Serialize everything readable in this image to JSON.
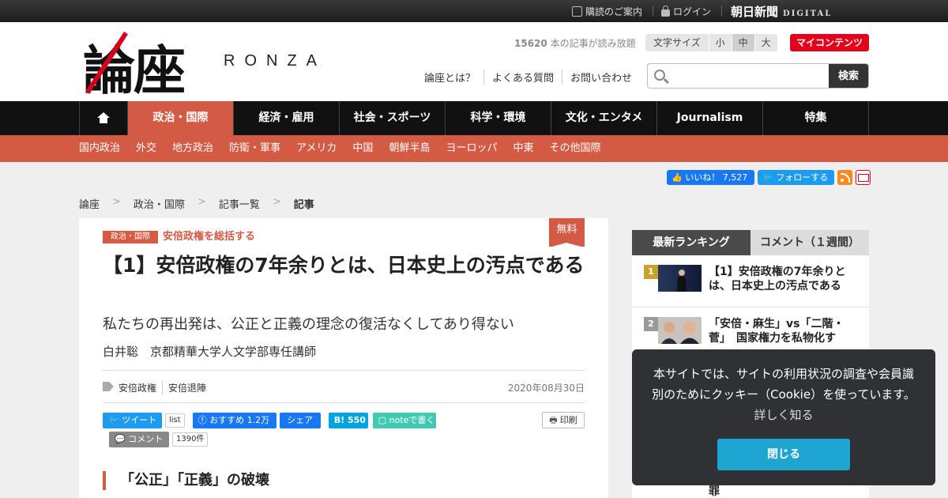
{
  "topbar": {
    "subscription": "購読のご案内",
    "login": "ログイン",
    "brand": "朝日新聞",
    "brand_sub": "DIGITAL"
  },
  "header": {
    "logo_kanji": "論座",
    "logo_roman": "RONZA",
    "read_count": "15620",
    "read_count_suffix": " 本の記事が読み放題",
    "font_size_label": "文字サイズ",
    "font_sizes": [
      "小",
      "中",
      "大"
    ],
    "font_size_selected": "中",
    "my_contents": "マイコンテンツ",
    "links": [
      "論座とは？",
      "よくある質問",
      "お問い合わせ"
    ],
    "search_placeholder": "",
    "search_button": "検索"
  },
  "nav": {
    "items": [
      "政治・国際",
      "経済・雇用",
      "社会・スポーツ",
      "科学・環境",
      "文化・エンタメ",
      "Journalism",
      "特集"
    ],
    "active": "政治・国際"
  },
  "subnav": {
    "items": [
      "国内政治",
      "外交",
      "地方政治",
      "防衛・軍事",
      "アメリカ",
      "中国",
      "朝鮮半島",
      "ヨーロッパ",
      "中東",
      "その他国際"
    ]
  },
  "social": {
    "fb_like": "いいね！",
    "fb_like_count": "7,527",
    "tw_follow": "フォローする"
  },
  "breadcrumb": [
    "論座",
    "政治・国際",
    "記事一覧",
    "記事"
  ],
  "article": {
    "free_badge": "無料",
    "category": "政治・国際",
    "series": "安倍政権を総括する",
    "title": "【1】安倍政権の7年余りとは、日本史上の汚点である",
    "subtitle": "私たちの再出発は、公正と正義の理念の復活なくしてあり得ない",
    "author": "白井聡　京都精華大学人文学部専任講師",
    "tags": [
      "安倍政権",
      "安倍退陣"
    ],
    "date": "2020年08月30日",
    "share": {
      "tweet": "ツイート",
      "tweet_count": "list",
      "fb_recommend": "おすすめ",
      "fb_count": "1.2万",
      "fb_share": "シェア",
      "hatena_mark": "B!",
      "hatena_count": "550",
      "note": "noteで書く",
      "print": "印刷",
      "comment": "コメント",
      "comment_count": "1390件"
    },
    "section_heading": "「公正」「正義」の破壊"
  },
  "ranking": {
    "tab_latest": "最新ランキング",
    "tab_comment": "コメント（１週間）",
    "items": [
      {
        "rank": "1",
        "title": "【1】安倍政権の7年余りとは、日本史上の汚点である",
        "color": "#c9a227"
      },
      {
        "rank": "2",
        "title": "「安倍・麻生」vs「二階・菅」　国家権力を私物化す",
        "color": "#9a9a9a"
      }
    ],
    "trailing_glyph": "罪"
  },
  "cookie": {
    "text": "本サイトでは、サイトの利用状況の調査や会員識別のためにクッキー（Cookie）を使っています。",
    "link": "詳しく知る",
    "button": "閉じる"
  },
  "colors": {
    "accent": "#d35a43",
    "nav_bg": "#111111",
    "brand_red": "#e4001c",
    "cookie_button": "#1ea5d2"
  }
}
